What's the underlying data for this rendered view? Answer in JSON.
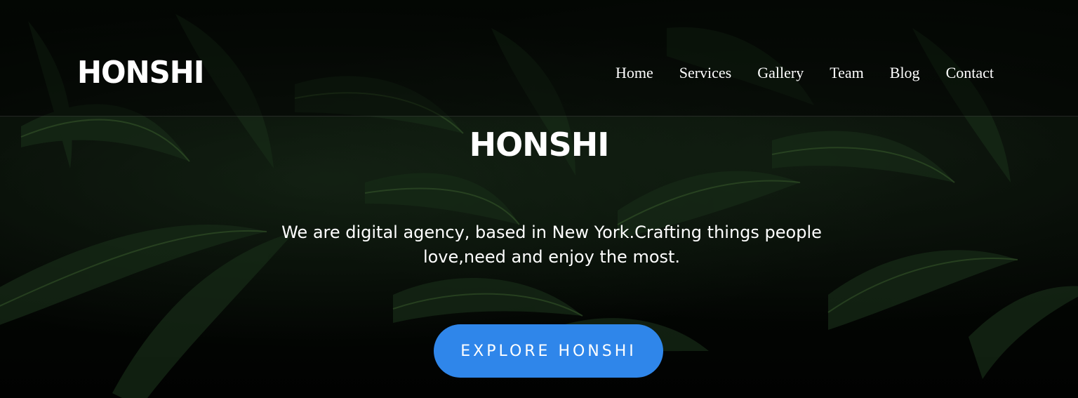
{
  "nav": {
    "logo": "HONSHI",
    "links": [
      "Home",
      "Services",
      "Gallery",
      "Team",
      "Blog",
      "Contact"
    ]
  },
  "hero": {
    "title": "HONSHI",
    "subtitle": "We are digital agency, based in New York.Crafting things people love,need and enjoy the most.",
    "cta_label": "EXPLORE HONSHI",
    "background_image": "dark-tropical-leaves"
  },
  "colors": {
    "accent": "#2f86ea",
    "overlay": "#000000",
    "text": "#ffffff"
  }
}
